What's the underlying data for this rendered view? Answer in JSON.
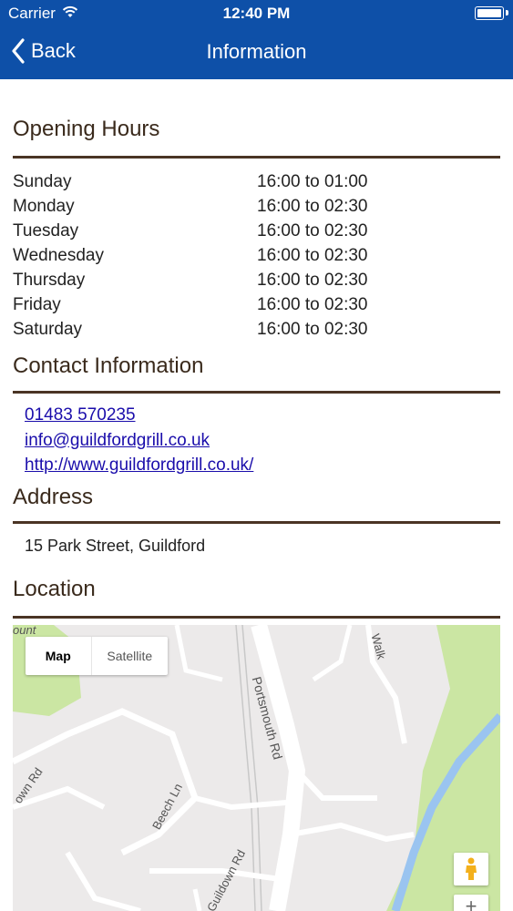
{
  "status_bar": {
    "carrier": "Carrier",
    "time": "12:40 PM"
  },
  "nav": {
    "back_label": "Back",
    "title": "Information"
  },
  "opening_hours": {
    "title": "Opening Hours",
    "rows": [
      {
        "day": "Sunday",
        "hours": "16:00 to 01:00"
      },
      {
        "day": "Monday",
        "hours": "16:00 to 02:30"
      },
      {
        "day": "Tuesday",
        "hours": "16:00 to 02:30"
      },
      {
        "day": "Wednesday",
        "hours": "16:00 to 02:30"
      },
      {
        "day": "Thursday",
        "hours": "16:00 to 02:30"
      },
      {
        "day": "Friday",
        "hours": "16:00 to 02:30"
      },
      {
        "day": "Saturday",
        "hours": "16:00 to 02:30"
      }
    ]
  },
  "contact": {
    "title": "Contact Information",
    "phone": "01483 570235",
    "email": "info@guildfordgrill.co.uk",
    "website": "http://www.guildfordgrill.co.uk/"
  },
  "address": {
    "title": "Address",
    "text": "15 Park Street, Guildford"
  },
  "location": {
    "title": "Location",
    "map_button": "Map",
    "satellite_button": "Satellite",
    "road_labels": [
      "Portsmouth Rd",
      "Beech Ln",
      "Guildown Rd",
      "own Rd",
      "Walk",
      "ount"
    ],
    "zoom_in": "+"
  },
  "colors": {
    "brand": "#0e50a8",
    "heading": "#3a2a1c",
    "rule": "#4a3424",
    "link": "#1a0dab"
  }
}
